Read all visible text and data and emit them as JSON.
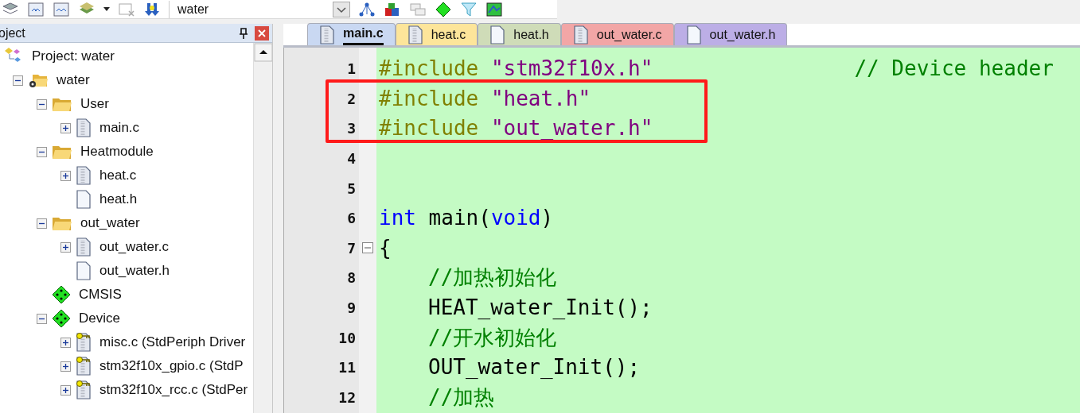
{
  "toolbar": {
    "target": "water"
  },
  "project_panel": {
    "title": "oject",
    "tree": [
      {
        "label": "Project: water",
        "kind": "project",
        "children": [
          {
            "label": "water",
            "kind": "target",
            "expanded": true,
            "children": [
              {
                "label": "User",
                "kind": "folder",
                "expanded": true,
                "children": [
                  {
                    "label": "main.c",
                    "kind": "source",
                    "expanded": false
                  }
                ]
              },
              {
                "label": "Heatmodule",
                "kind": "folder",
                "expanded": true,
                "children": [
                  {
                    "label": "heat.c",
                    "kind": "source",
                    "expanded": false
                  },
                  {
                    "label": "heat.h",
                    "kind": "header"
                  }
                ]
              },
              {
                "label": "out_water",
                "kind": "folder",
                "expanded": true,
                "children": [
                  {
                    "label": "out_water.c",
                    "kind": "source",
                    "expanded": false
                  },
                  {
                    "label": "out_water.h",
                    "kind": "header"
                  }
                ]
              },
              {
                "label": "CMSIS",
                "kind": "component"
              },
              {
                "label": "Device",
                "kind": "component",
                "expanded": true,
                "children": [
                  {
                    "label": "misc.c (StdPeriph Driver",
                    "kind": "locked",
                    "expanded": false
                  },
                  {
                    "label": "stm32f10x_gpio.c (StdP",
                    "kind": "locked",
                    "expanded": false
                  },
                  {
                    "label": "stm32f10x_rcc.c (StdPer",
                    "kind": "locked",
                    "expanded": false
                  }
                ]
              }
            ]
          }
        ]
      }
    ]
  },
  "tabs": [
    {
      "label": "main.c",
      "selected": true,
      "color": "#c9d8f2",
      "kind": "source"
    },
    {
      "label": "heat.c",
      "selected": false,
      "color": "#fde59a",
      "kind": "source"
    },
    {
      "label": "heat.h",
      "selected": false,
      "color": "#cfdcb8",
      "kind": "header"
    },
    {
      "label": "out_water.c",
      "selected": false,
      "color": "#f2a6a6",
      "kind": "source"
    },
    {
      "label": "out_water.h",
      "selected": false,
      "color": "#bcaee6",
      "kind": "header"
    }
  ],
  "editor": {
    "lines": [
      {
        "number": "1",
        "tokens": [
          {
            "kind": "directive",
            "text": "#include "
          },
          {
            "kind": "string",
            "text": "\"stm32f10x.h\""
          }
        ],
        "comment": "// Device header"
      },
      {
        "number": "2",
        "tokens": [
          {
            "kind": "directive",
            "text": "#include "
          },
          {
            "kind": "string",
            "text": "\"heat.h\""
          }
        ]
      },
      {
        "number": "3",
        "tokens": [
          {
            "kind": "directive",
            "text": "#include "
          },
          {
            "kind": "string",
            "text": "\"out_water.h\""
          }
        ]
      },
      {
        "number": "4"
      },
      {
        "number": "5"
      },
      {
        "number": "6",
        "tokens": [
          {
            "kind": "keyword",
            "text": "int"
          },
          {
            "kind": "plain",
            "text": " main("
          },
          {
            "kind": "keyword",
            "text": "void"
          },
          {
            "kind": "plain",
            "text": ")"
          }
        ]
      },
      {
        "number": "7",
        "fold_expanded": true,
        "tokens": [
          {
            "kind": "plain",
            "text": "{"
          }
        ]
      },
      {
        "number": "8",
        "indented": true,
        "tokens": [
          {
            "kind": "comment",
            "text": "//加热初始化"
          }
        ]
      },
      {
        "number": "9",
        "indented": true,
        "tokens": [
          {
            "kind": "plain",
            "text": "HEAT_water_Init();"
          }
        ]
      },
      {
        "number": "10",
        "indented": true,
        "tokens": [
          {
            "kind": "comment",
            "text": "//开水初始化"
          }
        ]
      },
      {
        "number": "11",
        "indented": true,
        "tokens": [
          {
            "kind": "plain",
            "text": "OUT_water_Init();"
          }
        ]
      },
      {
        "number": "12",
        "indented": true,
        "tokens": [
          {
            "kind": "comment",
            "text": "//加热"
          }
        ]
      }
    ]
  }
}
